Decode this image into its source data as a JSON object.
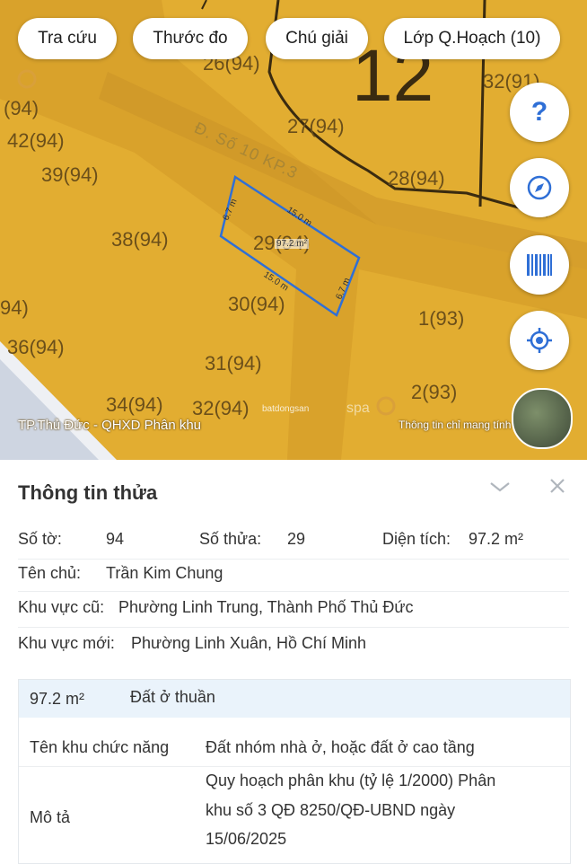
{
  "toolbar": {
    "lookup_label": "Tra cứu",
    "measure_label": "Thước đo",
    "legend_label": "Chú giải",
    "layer_label": "Lớp Q.Hoạch (10)"
  },
  "map": {
    "block_number": "12",
    "road_name": "Đ. Số 10 KP.3",
    "plot_labels": [
      "26(94)",
      "27(94)",
      "28(94)",
      "32(91)",
      "(94)",
      "42(94)",
      "39(94)",
      "38(94)",
      "29(94)",
      "30(94)",
      "94)",
      "36(94)",
      "31(94)",
      "34(94)",
      "32(94)",
      "1(93)",
      "2(93)"
    ],
    "dimensions": {
      "length": "15.0 m",
      "width": "6.7 m",
      "area": "97.2 m²"
    },
    "caption_left": "TP.Thủ Đức - QHXD Phân khu",
    "caption_right": "Thông tin chỉ mang tính",
    "watermark_brand": "batdongsan",
    "watermark_tail": "spa",
    "icons": {
      "help": "help-icon",
      "compass": "compass-icon",
      "barcode": "barcode-icon",
      "locate": "locate-icon"
    },
    "accent_color": "#2f6fd6"
  },
  "panel": {
    "title": "Thông tin thửa",
    "sheet_label": "Số tờ:",
    "sheet_value": "94",
    "parcel_label": "Số thửa:",
    "parcel_value": "29",
    "area_label": "Diện tích:",
    "area_value": "97.2 m²",
    "owner_label": "Tên chủ:",
    "owner_value": "Trần Kim Chung",
    "old_area_label": "Khu vực cũ:",
    "old_area_value": "Phường Linh Trung, Thành Phố Thủ Đức",
    "new_area_label": "Khu vực mới:",
    "new_area_value": "Phường Linh Xuân, Hồ Chí Minh",
    "zone": {
      "area": "97.2 m²",
      "type": "Đất ở thuần",
      "function_label": "Tên khu chức năng",
      "function_value": "Đất nhóm nhà ở, hoặc đất ở cao tầng",
      "desc_label": "Mô tả",
      "desc_lines": [
        "Quy hoạch phân khu (tỷ lệ 1/2000) Phân",
        "khu số 3 QĐ 8250/QĐ-UBND ngày",
        "15/06/2025"
      ]
    }
  }
}
